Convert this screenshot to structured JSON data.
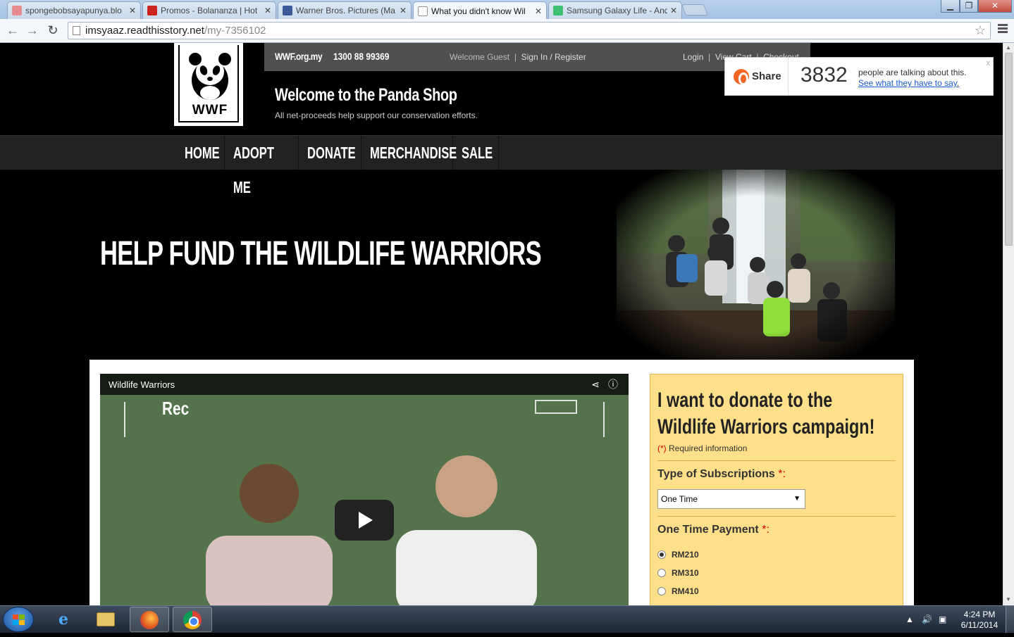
{
  "browser": {
    "tabs": [
      {
        "title": "spongebobsayapunya.blo",
        "favicon_color": "#e58b8b"
      },
      {
        "title": "Promos - Bolananza | Hot",
        "favicon_color": "#cc2222"
      },
      {
        "title": "Warner Bros. Pictures (Ma",
        "favicon_color": "#3b5998"
      },
      {
        "title": "What you didn't know Wil",
        "favicon_color": "#ffffff"
      },
      {
        "title": "Samsung Galaxy Life - And",
        "favicon_color": "#3fbf6f"
      }
    ],
    "url_host": "imsyaaz.readthisstory.net",
    "url_path": "/my-7356102"
  },
  "header": {
    "logo_text": "WWF",
    "site": "WWF.org.my",
    "phone": "1300 88 99369",
    "welcome_guest": "Welcome Guest",
    "sign_in": "Sign In / Register",
    "login": "Login",
    "view_cart": "View Cart",
    "checkout": "Checkout",
    "title": "Welcome to the Panda Shop",
    "tagline": "All net-proceeds help support our conservation efforts."
  },
  "share_widget": {
    "button": "Share",
    "count": "3832",
    "talking": "people are talking about this.",
    "see_link": "See what they have to say",
    "close": "x"
  },
  "nav": {
    "items": [
      "HOME",
      "ADOPT ME",
      "DONATE",
      "MERCHANDISE",
      "SALE"
    ]
  },
  "hero": {
    "title": "HELP FUND THE WILDLIFE WARRIORS"
  },
  "video": {
    "title": "Wildlife Warriors",
    "rec": "Rec"
  },
  "donate": {
    "heading": "I want to donate to the Wildlife Warriors campaign!",
    "required_prefix": "(*)",
    "required_text": " Required information",
    "subscription_label": "Type of Subscriptions",
    "subscription_value": "One Time",
    "payment_label": "One Time Payment",
    "options": [
      "RM210",
      "RM310",
      "RM410"
    ],
    "selected_option": "RM210"
  },
  "taskbar": {
    "time": "4:24 PM",
    "date": "6/11/2014"
  },
  "colors": {
    "donate_bg": "#ffe08a",
    "share_orange": "#f26522",
    "link_blue": "#1a5bd0"
  }
}
